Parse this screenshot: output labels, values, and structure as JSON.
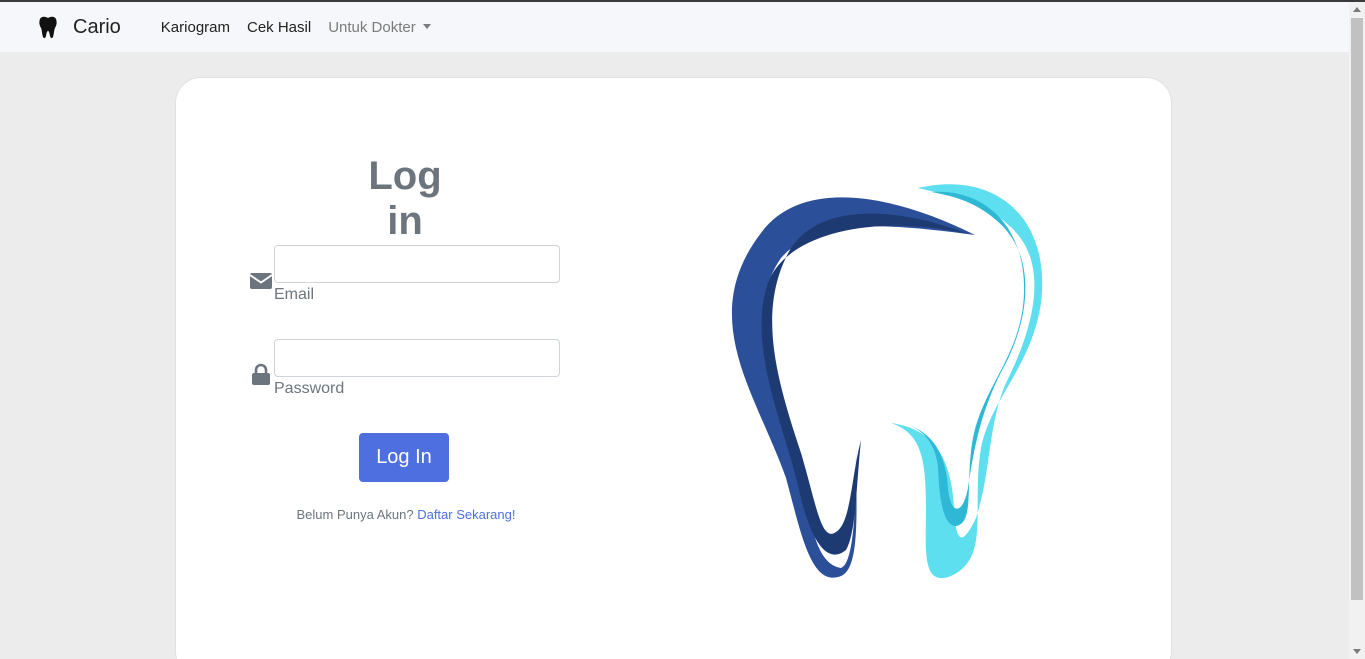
{
  "navbar": {
    "brand": {
      "icon": "tooth-icon",
      "text": "Cario"
    },
    "links": [
      {
        "label": "Kariogram"
      },
      {
        "label": "Cek Hasil"
      }
    ],
    "dropdown": {
      "label": "Untuk Dokter",
      "icon": "caret-down-icon"
    }
  },
  "login": {
    "title": "Log in",
    "email": {
      "icon": "envelope-icon",
      "label": "Email",
      "value": "",
      "placeholder": ""
    },
    "password": {
      "icon": "lock-icon",
      "label": "Password",
      "value": "",
      "placeholder": ""
    },
    "button_label": "Log In",
    "register_prompt": "Belum Punya Akun?",
    "register_link": "Daftar Sekarang!"
  },
  "illustration": {
    "icon": "tooth-logo-icon"
  },
  "colors": {
    "accent": "#4e6fe0",
    "navbar_bg": "#f6f7fa",
    "page_bg": "#ececec",
    "tooth_dark_blue": "#1e3a73",
    "tooth_blue": "#2b4f98",
    "tooth_cyan": "#2fb8d6",
    "tooth_light_cyan": "#5ddfef"
  }
}
